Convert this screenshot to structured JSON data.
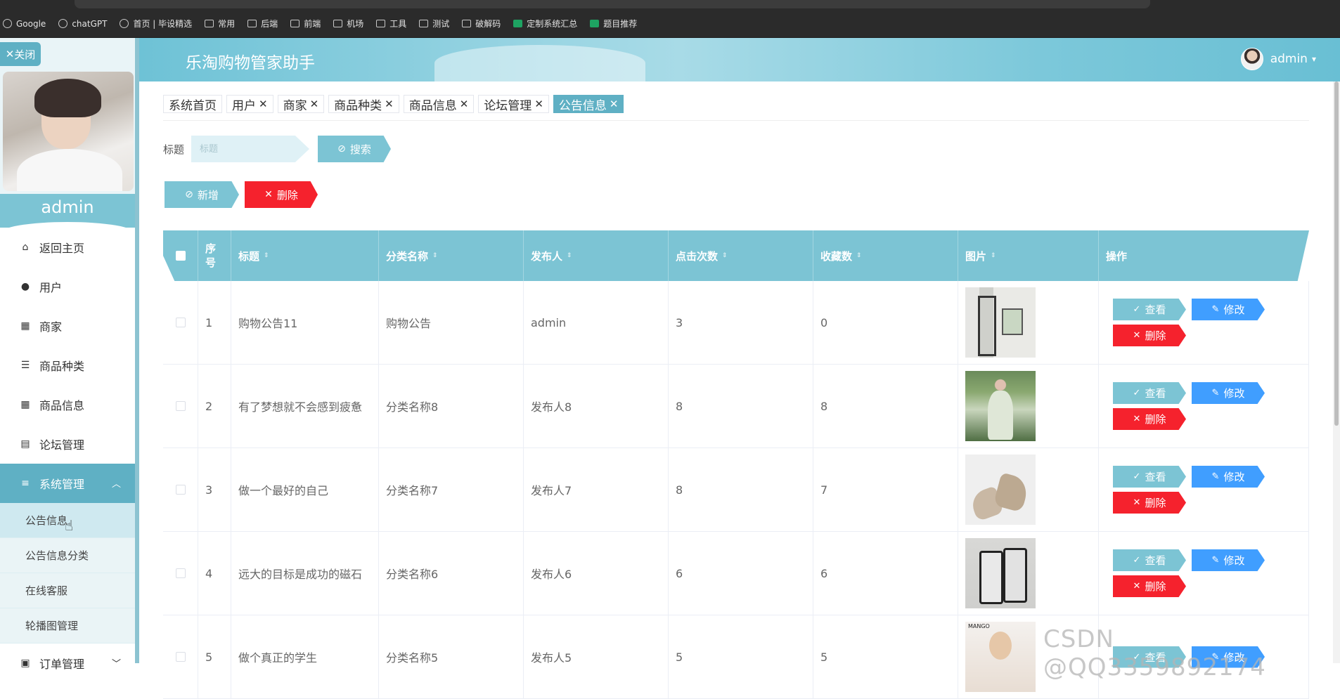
{
  "browser": {
    "bookmarks": [
      {
        "label": "Google",
        "icon": "google-icon"
      },
      {
        "label": "chatGPT",
        "icon": "chatgpt-icon"
      },
      {
        "label": "首页 | 毕设精选",
        "icon": "site-icon"
      },
      {
        "label": "常用",
        "icon": "folder-icon"
      },
      {
        "label": "后端",
        "icon": "folder-icon"
      },
      {
        "label": "前端",
        "icon": "folder-icon"
      },
      {
        "label": "机场",
        "icon": "folder-icon"
      },
      {
        "label": "工具",
        "icon": "folder-icon"
      },
      {
        "label": "测试",
        "icon": "folder-icon"
      },
      {
        "label": "破解码",
        "icon": "folder-icon"
      },
      {
        "label": "定制系统汇总",
        "icon": "sheet-icon"
      },
      {
        "label": "题目推荐",
        "icon": "sheet-icon"
      }
    ]
  },
  "sidebar": {
    "close_label": "关闭",
    "username": "admin",
    "menu": [
      {
        "label": "返回主页",
        "icon": "home-icon"
      },
      {
        "label": "用户",
        "icon": "user-icon"
      },
      {
        "label": "商家",
        "icon": "grid-icon"
      },
      {
        "label": "商品种类",
        "icon": "list-icon"
      },
      {
        "label": "商品信息",
        "icon": "grid-icon"
      },
      {
        "label": "论坛管理",
        "icon": "clipboard-icon"
      },
      {
        "label": "系统管理",
        "icon": "sliders-icon"
      }
    ],
    "submenu": [
      "公告信息",
      "公告信息分类",
      "在线客服",
      "轮播图管理"
    ],
    "next_menu": "订单管理"
  },
  "header": {
    "title": "乐淘购物管家助手",
    "user": "admin"
  },
  "tabs": [
    {
      "label": "系统首页",
      "closable": false
    },
    {
      "label": "用户",
      "closable": true
    },
    {
      "label": "商家",
      "closable": true
    },
    {
      "label": "商品种类",
      "closable": true
    },
    {
      "label": "商品信息",
      "closable": true
    },
    {
      "label": "论坛管理",
      "closable": true
    },
    {
      "label": "公告信息",
      "closable": true,
      "active": true
    }
  ],
  "search": {
    "label": "标题",
    "placeholder": "标题",
    "button": "搜索"
  },
  "actions": {
    "add": "新增",
    "delete": "删除"
  },
  "table": {
    "headers": {
      "index_a": "序",
      "index_b": "号",
      "title": "标题",
      "category": "分类名称",
      "publisher": "发布人",
      "clicks": "点击次数",
      "favorites": "收藏数",
      "image": "图片",
      "operations": "操作"
    },
    "op_labels": {
      "view": "查看",
      "edit": "修改",
      "delete": "删除"
    },
    "rows": [
      {
        "no": "1",
        "title": "购物公告11",
        "category": "购物公告",
        "publisher": "admin",
        "clicks": "3",
        "favorites": "0",
        "image": "mirror-image"
      },
      {
        "no": "2",
        "title": "有了梦想就不会感到疲惫",
        "category": "分类名称8",
        "publisher": "发布人8",
        "clicks": "8",
        "favorites": "8",
        "image": "dress-image"
      },
      {
        "no": "3",
        "title": "做一个最好的自己",
        "category": "分类名称7",
        "publisher": "发布人7",
        "clicks": "8",
        "favorites": "7",
        "image": "shoes-image"
      },
      {
        "no": "4",
        "title": "远大的目标是成功的磁石",
        "category": "分类名称6",
        "publisher": "发布人6",
        "clicks": "6",
        "favorites": "6",
        "image": "phones-image"
      },
      {
        "no": "5",
        "title": "做个真正的学生",
        "category": "分类名称5",
        "publisher": "发布人5",
        "clicks": "5",
        "favorites": "5",
        "image": "model-image"
      }
    ]
  },
  "watermark": "CSDN @QQ3359892174",
  "colors": {
    "primary": "#7cc4d4",
    "danger": "#f5222d",
    "edit": "#409eff",
    "active_tab": "#5fb0c4"
  }
}
